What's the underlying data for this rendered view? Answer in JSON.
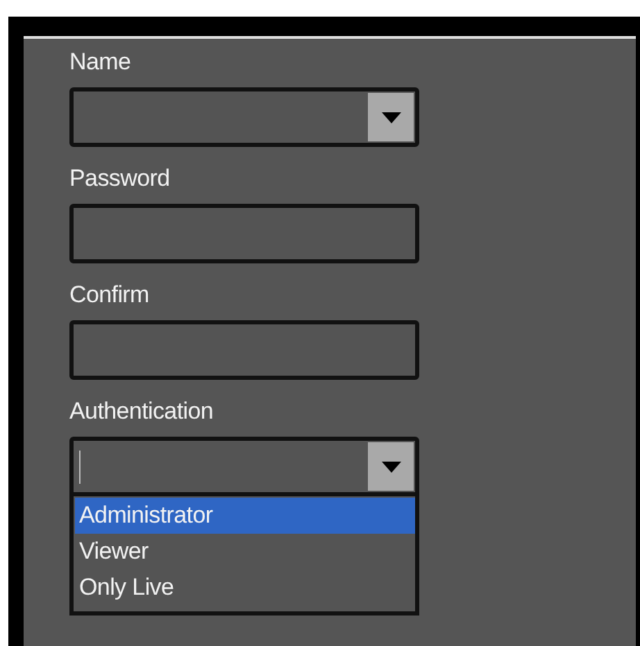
{
  "fields": [
    {
      "kind": "combo",
      "label": "Name"
    },
    {
      "kind": "text",
      "label": "Password"
    },
    {
      "kind": "text",
      "label": "Confirm"
    },
    {
      "kind": "combo",
      "label": "Authentication",
      "options": [
        {
          "label": "Administrator",
          "selected": true
        },
        {
          "label": "Viewer",
          "selected": false
        },
        {
          "label": "Only Live",
          "selected": false
        }
      ]
    }
  ]
}
